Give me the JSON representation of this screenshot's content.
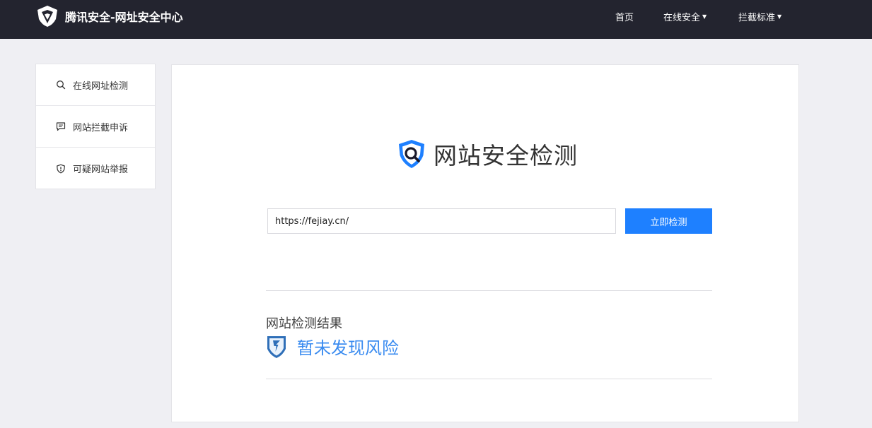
{
  "header": {
    "brand_title": "腾讯安全-网址安全中心",
    "nav": [
      {
        "label": "首页",
        "has_dropdown": false
      },
      {
        "label": "在线安全",
        "has_dropdown": true
      },
      {
        "label": "拦截标准",
        "has_dropdown": true
      }
    ]
  },
  "sidebar": {
    "items": [
      {
        "label": "在线网址检测",
        "icon": "search-icon"
      },
      {
        "label": "网站拦截申诉",
        "icon": "message-icon"
      },
      {
        "label": "可疑网站举报",
        "icon": "shield-alert-icon"
      }
    ]
  },
  "main": {
    "title": "网站安全检测",
    "url_input_value": "https://fejiay.cn/",
    "detect_button_label": "立即检测",
    "result_label": "网站检测结果",
    "result_text": "暂未发现风险"
  },
  "colors": {
    "topbar": "#23242f",
    "accent": "#1e80ff",
    "result_blue": "#3b8cf0",
    "page_bg": "#efeff3"
  }
}
